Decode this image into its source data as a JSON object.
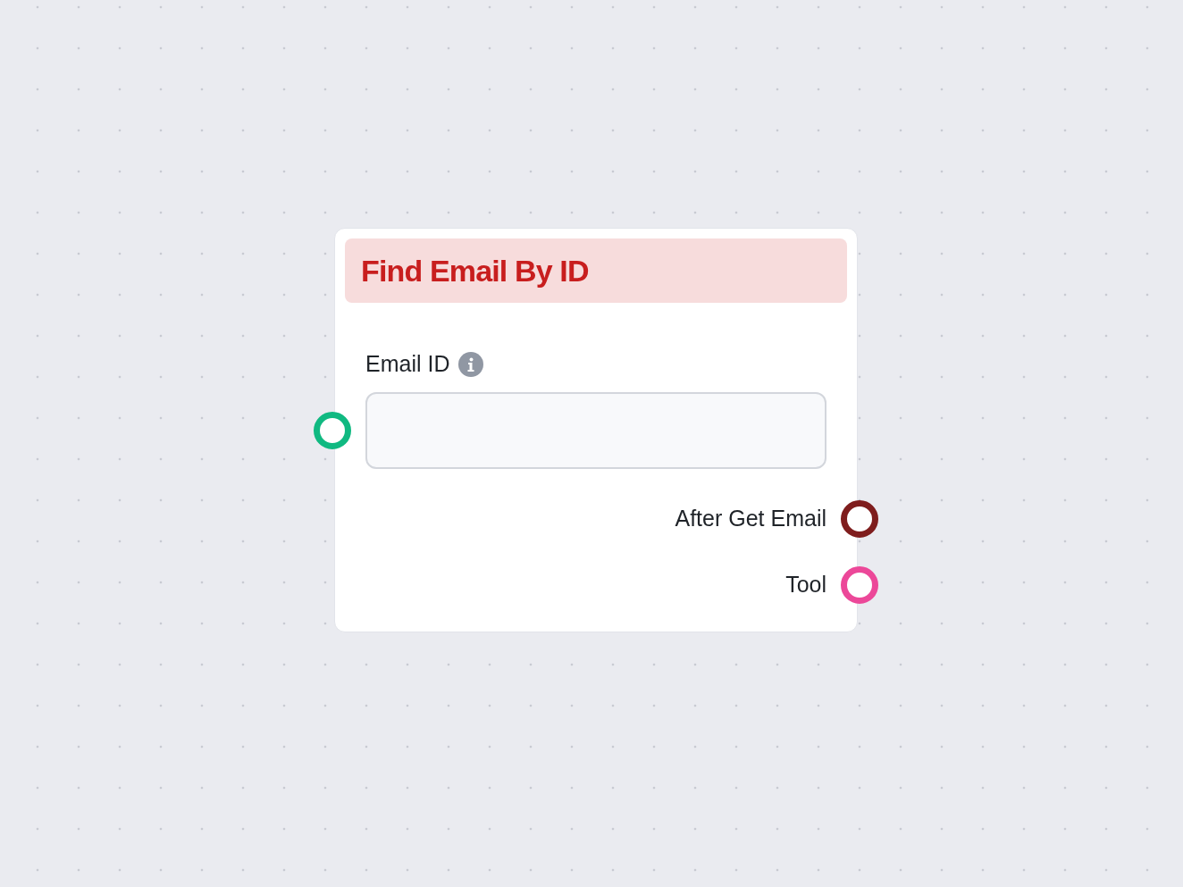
{
  "node": {
    "title": "Find Email By ID",
    "fields": [
      {
        "label": "Email ID",
        "info": true,
        "color": "#10b981"
      }
    ],
    "outputs": [
      {
        "label": "After Get Email",
        "color": "#7f1d1d"
      },
      {
        "label": "Tool",
        "color": "#ec4899"
      }
    ]
  }
}
